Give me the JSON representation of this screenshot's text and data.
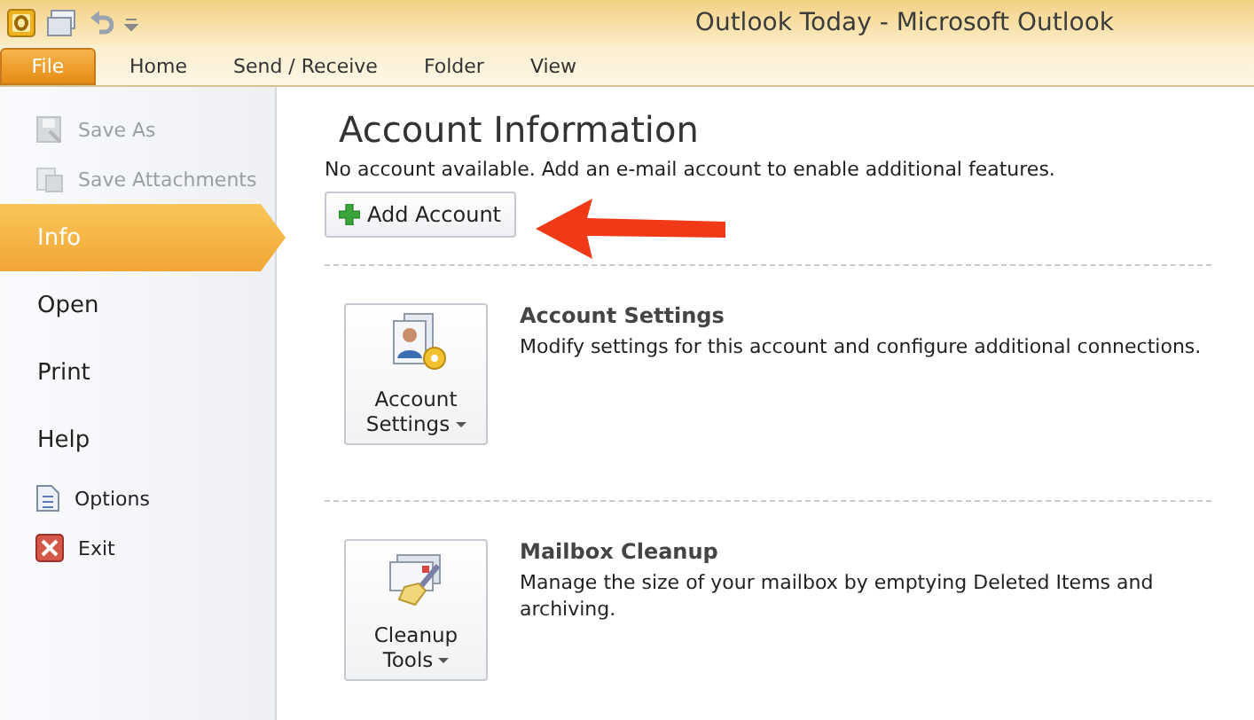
{
  "window": {
    "title": "Outlook Today  -  Microsoft Outlook"
  },
  "tabs": [
    {
      "label": "File",
      "selected": true
    },
    {
      "label": "Home",
      "selected": false
    },
    {
      "label": "Send / Receive",
      "selected": false
    },
    {
      "label": "Folder",
      "selected": false
    },
    {
      "label": "View",
      "selected": false
    }
  ],
  "sidebar": {
    "items": [
      {
        "kind": "command",
        "label": "Save As",
        "disabled": true
      },
      {
        "kind": "command",
        "label": "Save Attachments",
        "disabled": true
      },
      {
        "kind": "page",
        "label": "Info",
        "selected": true
      },
      {
        "kind": "page",
        "label": "Open",
        "selected": false
      },
      {
        "kind": "page",
        "label": "Print",
        "selected": false
      },
      {
        "kind": "page",
        "label": "Help",
        "selected": false
      },
      {
        "kind": "command",
        "label": "Options",
        "disabled": false
      },
      {
        "kind": "command",
        "label": "Exit",
        "disabled": false
      }
    ]
  },
  "account_info": {
    "title": "Account Information",
    "message": "No account available. Add an e-mail account to enable additional features.",
    "add_button": "Add Account"
  },
  "sections": [
    {
      "button": "Account Settings",
      "title": "Account Settings",
      "description": "Modify settings for this account and configure additional connections."
    },
    {
      "button": "Cleanup Tools",
      "title": "Mailbox Cleanup",
      "description": "Manage the size of your mailbox by emptying Deleted Items and archiving."
    }
  ]
}
